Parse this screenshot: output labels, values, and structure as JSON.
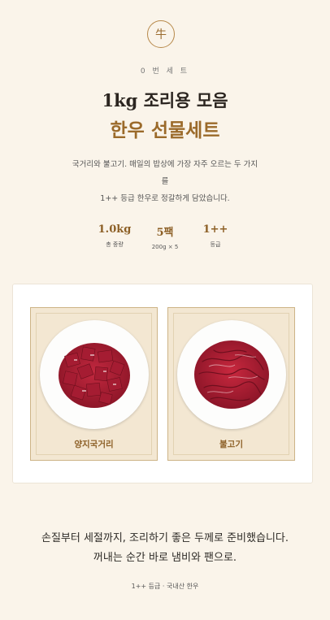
{
  "header": {
    "seal_char": "牛",
    "label": "0 번 세 트",
    "title_line1": "1kg 조리용 모음",
    "title_line2": "한우 선물세트"
  },
  "description": {
    "line1": "국거리와 불고기. 매일의 밥상에 가장 자주 오르는 두 가지",
    "line2": "를",
    "line3": "1++ 등급 한우로 정갈하게 담았습니다."
  },
  "stats": [
    {
      "value": "1.0kg",
      "sub": "총 중량"
    },
    {
      "value": "5팩",
      "sub": "200g × 5"
    },
    {
      "value": "1++",
      "sub": "등급"
    }
  ],
  "products": [
    {
      "label": "양지국거리",
      "icon": "beef-cubes-image"
    },
    {
      "label": "불고기",
      "icon": "sliced-beef-image"
    }
  ],
  "closing": {
    "line1": "손질부터 세절까지, 조리하기 좋은 두께로 준비했습니다.",
    "line2": "꺼내는 순간 바로 냄비와 팬으로."
  },
  "footnote": "1++ 등급 · 국내산 한우",
  "colors": {
    "background": "#faf4ea",
    "accent": "#9b6a2a",
    "tile": "#f3e7d2",
    "meat": "#b3213a"
  }
}
